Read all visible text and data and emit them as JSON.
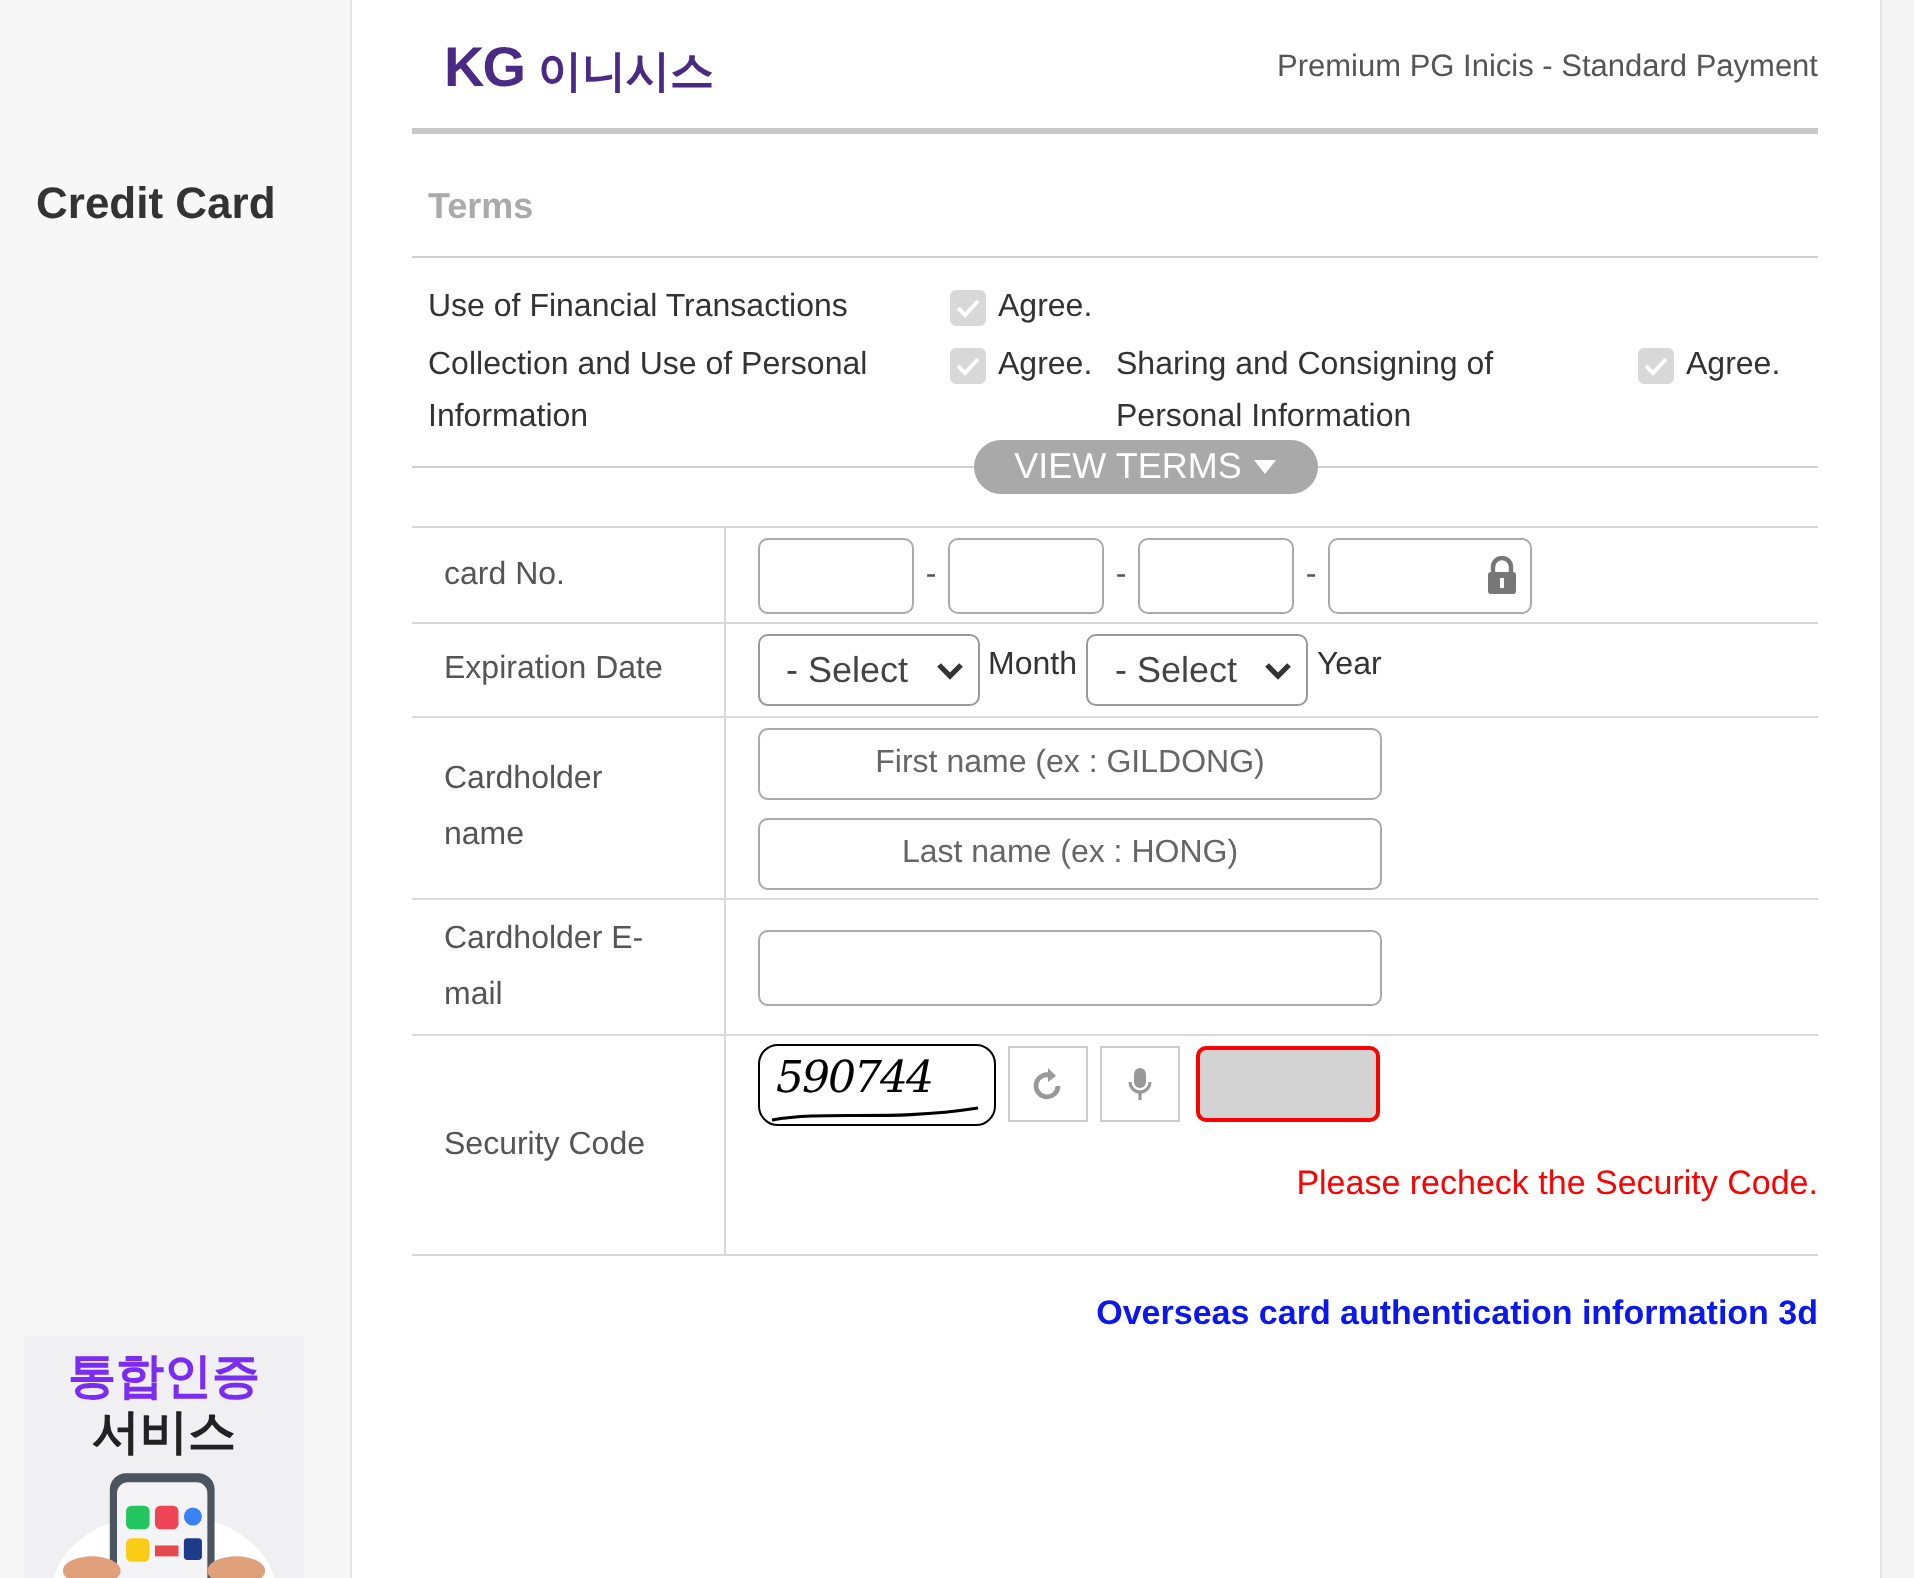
{
  "sidebar": {
    "title": "Credit Card",
    "banner": {
      "lines": [
        "통합인증",
        "서비스"
      ]
    }
  },
  "header": {
    "logo_mark": "KG",
    "logo_text": "이니시스",
    "subtitle": "Premium PG Inicis - Standard Payment"
  },
  "terms": {
    "title": "Terms",
    "rows": [
      [
        {
          "label": "Use of Financial Transactions",
          "agree": "Agree.",
          "checked": true,
          "disabled": true
        }
      ],
      [
        {
          "label": "Collection and Use of Personal Information",
          "agree": "Agree.",
          "checked": true,
          "disabled": true
        },
        {
          "label": "Sharing and Consigning of Personal Information",
          "agree": "Agree.",
          "checked": true,
          "disabled": true
        }
      ]
    ],
    "view_button": "VIEW TERMS",
    "expanded": false
  },
  "form": {
    "rows": [
      {
        "kind": "card_number",
        "label": "card No.",
        "fields": [
          {
            "masked": false
          },
          {
            "masked": false
          },
          {
            "masked": false
          },
          {
            "masked": true
          }
        ],
        "separators": [
          "-",
          "-",
          "-"
        ]
      },
      {
        "kind": "expiry",
        "label": "Expiration Date",
        "selects": [
          {
            "value": "- Select",
            "unit": "Month"
          },
          {
            "value": "- Select",
            "unit": "Year"
          }
        ]
      },
      {
        "kind": "name",
        "label": "Cardholder name",
        "inputs": [
          {
            "placeholder": "First name (ex : GILDONG)"
          },
          {
            "placeholder": "Last name (ex : HONG)"
          }
        ]
      },
      {
        "kind": "email",
        "label": "Cardholder E-mail"
      },
      {
        "kind": "captcha",
        "label": "Security Code",
        "captcha": "590744",
        "invalid": true,
        "error": "Please recheck the Security Code."
      }
    ]
  },
  "footer_link": "Overseas card authentication information 3d"
}
